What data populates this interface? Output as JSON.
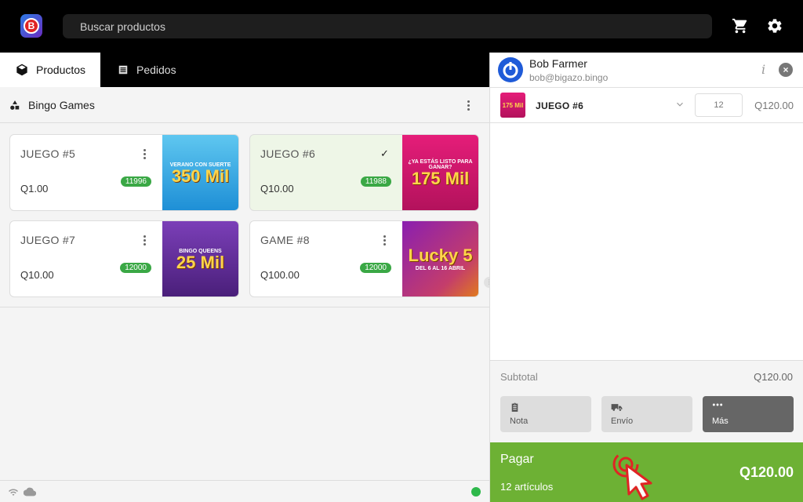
{
  "header": {
    "logo_letter": "B",
    "search_placeholder": "Buscar productos"
  },
  "tabs": [
    {
      "label": "Productos",
      "active": true
    },
    {
      "label": "Pedidos",
      "active": false
    }
  ],
  "category": {
    "title": "Bingo Games"
  },
  "products": [
    {
      "name": "JUEGO #5",
      "price": "Q1.00",
      "stock": "11996",
      "selected": false,
      "art_big": "350 Mil",
      "art_small": "VERANO CON SUERTE"
    },
    {
      "name": "JUEGO #6",
      "price": "Q10.00",
      "stock": "11988",
      "selected": true,
      "art_big": "175 Mil",
      "art_small": "¿YA ESTÁS LISTO PARA GANAR?"
    },
    {
      "name": "JUEGO #7",
      "price": "Q10.00",
      "stock": "12000",
      "selected": false,
      "art_big": "25 Mil",
      "art_small": "BINGO QUEENS"
    },
    {
      "name": "GAME #8",
      "price": "Q100.00",
      "stock": "12000",
      "selected": false,
      "art_big": "Lucky 5",
      "art_small": "DEL 6 AL 16 ABRIL"
    }
  ],
  "customer": {
    "name": "Bob Farmer",
    "email": "bob@bigazo.bingo"
  },
  "cart": {
    "items": [
      {
        "name": "JUEGO #6",
        "quantity": "12",
        "total": "Q120.00",
        "thumb_text": "175 Mil"
      }
    ],
    "subtotal_label": "Subtotal",
    "subtotal_value": "Q120.00",
    "actions": [
      {
        "label": "Nota",
        "icon": "clipboard-icon"
      },
      {
        "label": "Envío",
        "icon": "truck-icon"
      },
      {
        "label": "Más",
        "icon": "more-icon"
      }
    ],
    "pay": {
      "label": "Pagar",
      "count": "12 artículos",
      "total": "Q120.00"
    }
  },
  "colors": {
    "accent_green": "#6db134",
    "badge_green": "#3aa845",
    "online_green": "#2eb84b"
  }
}
